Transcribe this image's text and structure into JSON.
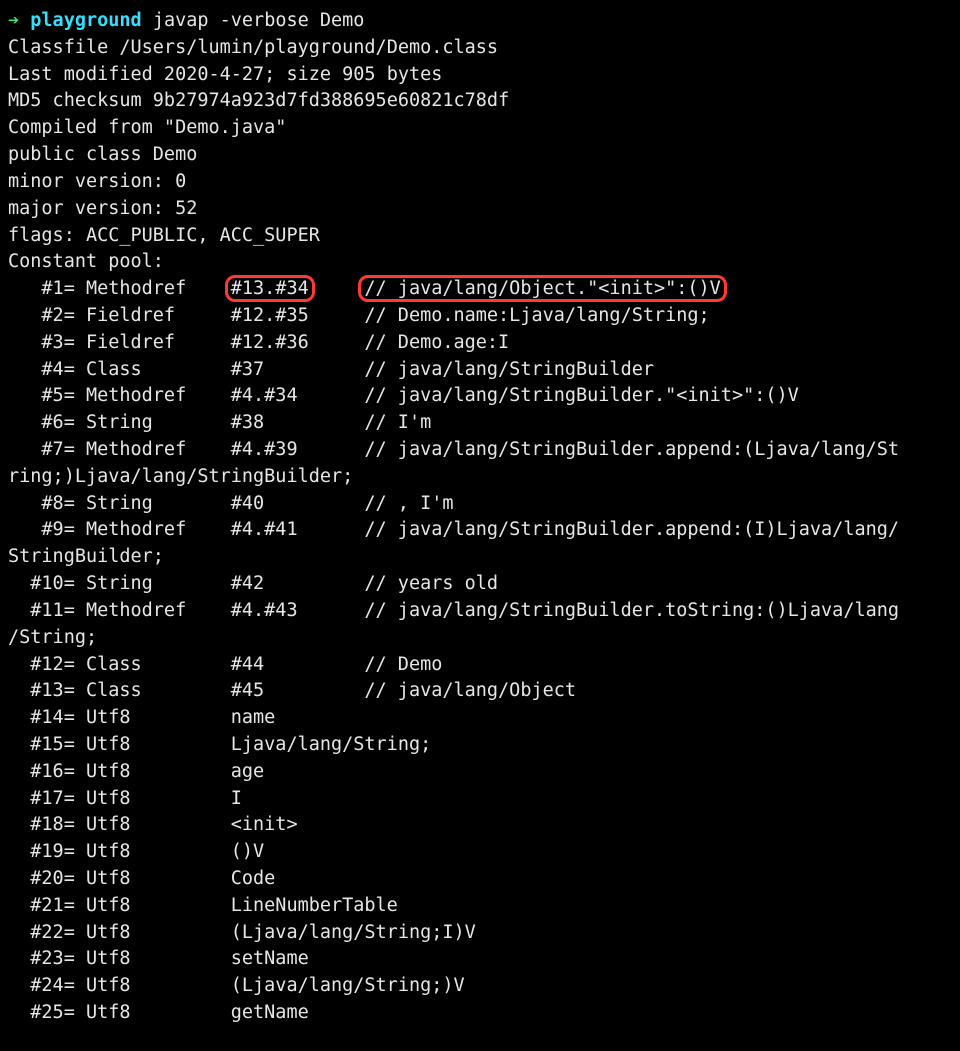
{
  "prompt": {
    "arrow": "➔",
    "cwd": "playground",
    "command": "javap -verbose Demo"
  },
  "lines": [
    "Classfile /Users/lumin/playground/Demo.class",
    "  Last modified 2020-4-27; size 905 bytes",
    "  MD5 checksum 9b27974a923d7fd388695e60821c78df",
    "  Compiled from \"Demo.java\"",
    "public class Demo",
    "  minor version: 0",
    "  major version: 52",
    "  flags: ACC_PUBLIC, ACC_SUPER",
    "Constant pool:"
  ],
  "constants": [
    {
      "idx": "#1",
      "type": "Methodref",
      "val": "#13.#34",
      "comment": "// java/lang/Object.\"<init>\":()V",
      "hl": true
    },
    {
      "idx": "#2",
      "type": "Fieldref",
      "val": "#12.#35",
      "comment": "// Demo.name:Ljava/lang/String;"
    },
    {
      "idx": "#3",
      "type": "Fieldref",
      "val": "#12.#36",
      "comment": "// Demo.age:I"
    },
    {
      "idx": "#4",
      "type": "Class",
      "val": "#37",
      "comment": "// java/lang/StringBuilder"
    },
    {
      "idx": "#5",
      "type": "Methodref",
      "val": "#4.#34",
      "comment": "// java/lang/StringBuilder.\"<init>\":()V"
    },
    {
      "idx": "#6",
      "type": "String",
      "val": "#38",
      "comment": "// I'm"
    },
    {
      "idx": "#7",
      "type": "Methodref",
      "val": "#4.#39",
      "comment": "// java/lang/StringBuilder.append:(Ljava/lang/St",
      "wrap": "ring;)Ljava/lang/StringBuilder;"
    },
    {
      "idx": "#8",
      "type": "String",
      "val": "#40",
      "comment": "//  , I'm"
    },
    {
      "idx": "#9",
      "type": "Methodref",
      "val": "#4.#41",
      "comment": "// java/lang/StringBuilder.append:(I)Ljava/lang/",
      "wrap": "StringBuilder;"
    },
    {
      "idx": "#10",
      "type": "String",
      "val": "#42",
      "comment": "//  years old"
    },
    {
      "idx": "#11",
      "type": "Methodref",
      "val": "#4.#43",
      "comment": "// java/lang/StringBuilder.toString:()Ljava/lang",
      "wrap": "/String;"
    },
    {
      "idx": "#12",
      "type": "Class",
      "val": "#44",
      "comment": "// Demo"
    },
    {
      "idx": "#13",
      "type": "Class",
      "val": "#45",
      "comment": "// java/lang/Object"
    },
    {
      "idx": "#14",
      "type": "Utf8",
      "val": "name",
      "comment": ""
    },
    {
      "idx": "#15",
      "type": "Utf8",
      "val": "Ljava/lang/String;",
      "comment": ""
    },
    {
      "idx": "#16",
      "type": "Utf8",
      "val": "age",
      "comment": ""
    },
    {
      "idx": "#17",
      "type": "Utf8",
      "val": "I",
      "comment": ""
    },
    {
      "idx": "#18",
      "type": "Utf8",
      "val": "<init>",
      "comment": ""
    },
    {
      "idx": "#19",
      "type": "Utf8",
      "val": "()V",
      "comment": ""
    },
    {
      "idx": "#20",
      "type": "Utf8",
      "val": "Code",
      "comment": ""
    },
    {
      "idx": "#21",
      "type": "Utf8",
      "val": "LineNumberTable",
      "comment": ""
    },
    {
      "idx": "#22",
      "type": "Utf8",
      "val": "(Ljava/lang/String;I)V",
      "comment": ""
    },
    {
      "idx": "#23",
      "type": "Utf8",
      "val": "setName",
      "comment": ""
    },
    {
      "idx": "#24",
      "type": "Utf8",
      "val": "(Ljava/lang/String;)V",
      "comment": ""
    },
    {
      "idx": "#25",
      "type": "Utf8",
      "val": "getName",
      "comment": ""
    }
  ]
}
